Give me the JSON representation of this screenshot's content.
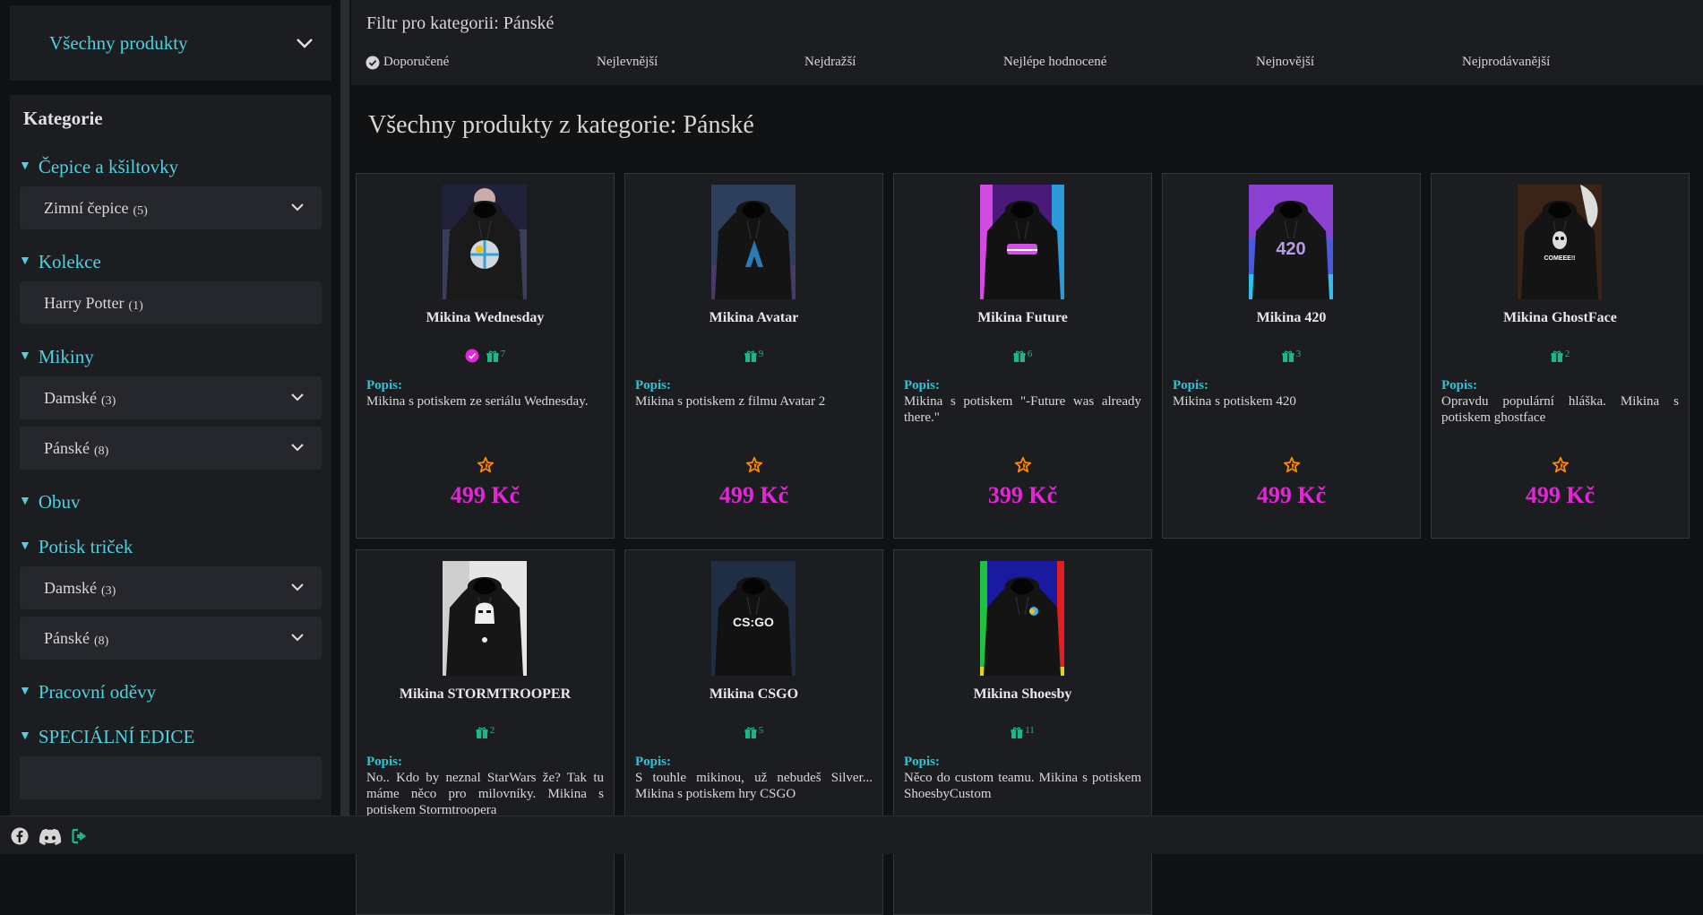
{
  "sidebar": {
    "all_products": "Všechny produkty",
    "categories_title": "Kategorie",
    "sections": [
      {
        "label": "Čepice a kšiltovky",
        "items": [
          {
            "label": "Zimní čepice",
            "count": "(5)",
            "chevron": true
          }
        ]
      },
      {
        "label": "Kolekce",
        "items": [
          {
            "label": "Harry Potter",
            "count": "(1)",
            "chevron": false
          }
        ]
      },
      {
        "label": "Mikiny",
        "items": [
          {
            "label": "Damské",
            "count": "(3)",
            "chevron": true
          },
          {
            "label": "Pánské",
            "count": "(8)",
            "chevron": true
          }
        ]
      },
      {
        "label": "Obuv",
        "items": []
      },
      {
        "label": "Potisk triček",
        "items": [
          {
            "label": "Damské",
            "count": "(3)",
            "chevron": true
          },
          {
            "label": "Pánské",
            "count": "(8)",
            "chevron": true
          }
        ]
      },
      {
        "label": "Pracovní oděvy",
        "items": []
      },
      {
        "label": "SPECIÁLNÍ EDICE",
        "items": [
          {
            "label": "",
            "count": "",
            "chevron": false
          }
        ]
      }
    ]
  },
  "filter": {
    "title": "Filtr pro kategorii: Pánské",
    "sort_options": [
      "Doporučené",
      "Nejlevnější",
      "Nejdražší",
      "Nejlépe hodnocené",
      "Nejnovější",
      "Nejprodávanější"
    ],
    "active_sort": "Doporučené"
  },
  "heading": "Všechny produkty z kategorie: Pánské",
  "popis_label": "Popis:",
  "products": [
    {
      "name": "Mikina Wednesday",
      "gift_count": "7",
      "has_badge": true,
      "description": "Mikina s potiskem ze seriálu Wednesday.",
      "price": "499 Kč",
      "img": "wednesday"
    },
    {
      "name": "Mikina Avatar",
      "gift_count": "9",
      "has_badge": false,
      "description": "Mikina s potiskem z filmu Avatar 2",
      "price": "499 Kč",
      "img": "avatar"
    },
    {
      "name": "Mikina Future",
      "gift_count": "6",
      "has_badge": false,
      "description": "Mikina s potiskem \"-Future was already there.\"",
      "price": "399 Kč",
      "img": "future"
    },
    {
      "name": "Mikina 420",
      "gift_count": "3",
      "has_badge": false,
      "description": "Mikina s potiskem 420",
      "price": "499 Kč",
      "img": "420"
    },
    {
      "name": "Mikina GhostFace",
      "gift_count": "2",
      "has_badge": false,
      "description": "Opravdu populární hláška. Mikina s potiskem ghostface",
      "price": "499 Kč",
      "img": "ghostface"
    },
    {
      "name": "Mikina STORMTROOPER",
      "gift_count": "2",
      "has_badge": false,
      "description": "No.. Kdo by neznal StarWars že? Tak tu máme něco pro milovníky. Mikina s potiskem Stormtroopera",
      "price": "",
      "img": "stormtrooper"
    },
    {
      "name": "Mikina CSGO",
      "gift_count": "5",
      "has_badge": false,
      "description": "S touhle mikinou, už nebudeš Silver... Mikina s potiskem hry CSGO",
      "price": "",
      "img": "csgo"
    },
    {
      "name": "Mikina Shoesby",
      "gift_count": "11",
      "has_badge": false,
      "description": "Něco do custom teamu. Mikina s potiskem ShoesbyCustom",
      "price": "",
      "img": "shoesby"
    }
  ],
  "img_text": {
    "420": "420",
    "ghostface": "COMEEE!!",
    "csgo": "CS:GO"
  },
  "footer_icons": [
    "facebook-icon",
    "discord-icon",
    "logout-icon"
  ],
  "colors": {
    "accent": "#4fd1e0",
    "price": "#e426d6",
    "gift": "#1fb58a",
    "star": "#ff8a00"
  }
}
